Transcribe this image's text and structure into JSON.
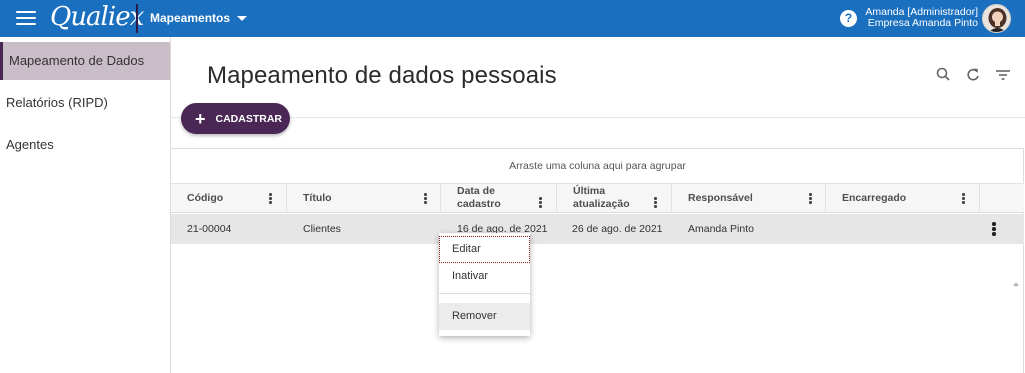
{
  "topbar": {
    "logo_text": "Qualiex",
    "module_label": "Mapeamentos",
    "help_label": "?",
    "user_name": "Amanda [Administrador]",
    "company": "Empresa Amanda Pinto",
    "brand_color": "#1b6fbf"
  },
  "sidebar": {
    "items": [
      {
        "label": "Mapeamento de Dados",
        "active": true
      },
      {
        "label": "Relatórios (RIPD)",
        "active": false
      },
      {
        "label": "Agentes",
        "active": false
      }
    ]
  },
  "main": {
    "title": "Mapeamento de dados pessoais",
    "add_label": "CADASTRAR",
    "add_icon": "+",
    "toolbar_icons": [
      "search-icon",
      "refresh-icon",
      "filter-icon"
    ]
  },
  "grid": {
    "group_hint": "Arraste uma coluna aqui para agrupar",
    "columns": [
      "Código",
      "Título",
      "Data de cadastro",
      "Última atualização",
      "Responsável",
      "Encarregado"
    ],
    "columns_split": {
      "data_line1": "Data de",
      "data_line2": "cadastro",
      "ult_line1": "Última",
      "ult_line2": "atualização"
    },
    "rows": [
      {
        "codigo": "21-00004",
        "titulo": "Clientes",
        "data_cadastro": "16 de ago. de 2021",
        "ultima_atualizacao": "26 de ago. de 2021",
        "responsavel": "Amanda Pinto",
        "encarregado": ""
      }
    ]
  },
  "context_menu": {
    "items": [
      "Editar",
      "Inativar",
      "Remover"
    ]
  }
}
